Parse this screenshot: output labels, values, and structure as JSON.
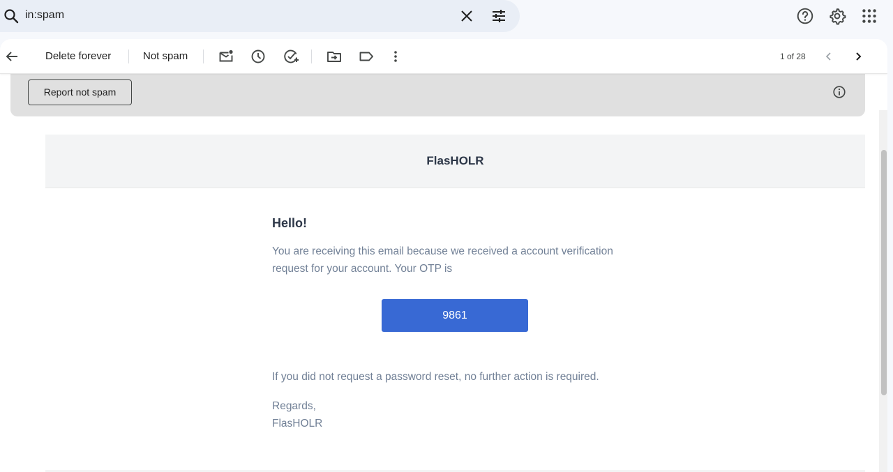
{
  "search": {
    "query": "in:spam",
    "icons": [
      "search-icon",
      "close-icon",
      "tune-icon"
    ]
  },
  "topbar": {
    "icons": [
      "help-icon",
      "settings-icon",
      "apps-grid-icon"
    ]
  },
  "toolbar": {
    "delete_label": "Delete forever",
    "not_spam_label": "Not spam",
    "icons": [
      "back-arrow-icon",
      "mark-unread-icon",
      "snooze-icon",
      "add-task-icon",
      "move-to-icon",
      "label-icon",
      "more-vert-icon",
      "prev-chevron-icon",
      "next-chevron-icon"
    ],
    "page_count": "1 of 28"
  },
  "banner": {
    "report_label": "Report not spam",
    "icon": "info-icon"
  },
  "email": {
    "brand": "FlasHOLR",
    "greeting": "Hello!",
    "intro": "You are receiving this email because we received a account verification request for your account. Your OTP is",
    "otp": "9861",
    "notice": "If you did not request a password reset, no further action is required.",
    "regards": "Regards,",
    "signature": "FlasHOLR"
  },
  "colors": {
    "accent_button": "#3869d4",
    "search_bg": "#e9eef6",
    "banner_bg": "#e0e0e0"
  }
}
